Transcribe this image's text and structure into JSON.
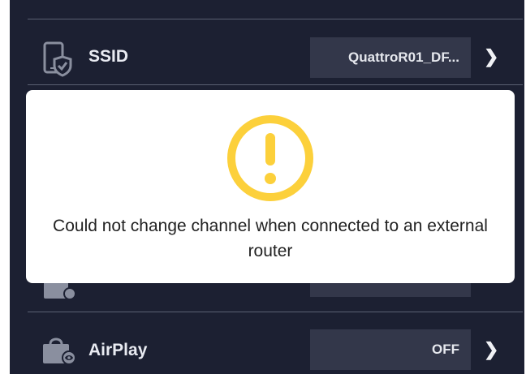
{
  "settings": {
    "rows": [
      {
        "label": "SSID",
        "value": "QuattroR01_DF...",
        "icon": "phone-shield-icon"
      },
      {
        "label": "",
        "value": "",
        "icon": "bag-cast-icon"
      },
      {
        "label": "AirPlay",
        "value": "OFF",
        "icon": "bag-cast-icon"
      }
    ],
    "chevron": "❯"
  },
  "alert": {
    "icon": "warning-icon",
    "icon_color": "#fcd03b",
    "message": "Could not change channel when connected to an external router"
  },
  "colors": {
    "panel_background": "#1c2032",
    "value_box": "#33374a",
    "divider": "#5b6072",
    "text": "#e9ebf2"
  }
}
